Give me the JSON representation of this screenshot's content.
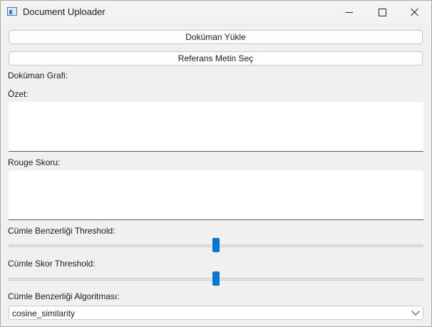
{
  "window": {
    "title": "Document Uploader",
    "app_icon": "window-app-icon"
  },
  "buttons": {
    "upload_document": "Doküman Yükle",
    "select_reference": "Referans Metin Seç"
  },
  "labels": {
    "document_graph": "Doküman Grafi:",
    "summary": "Özet:",
    "rouge_score": "Rouge Skoru:",
    "sentence_similarity_threshold": "Cümle Benzerliği Threshold:",
    "sentence_score_threshold": "Cümle Skor Threshold:",
    "similarity_algorithm": "Cümle Benzerliği Algoritması:"
  },
  "fields": {
    "summary_text": "",
    "rouge_text": ""
  },
  "sliders": {
    "similarity_threshold_fraction": 0.5,
    "score_threshold_fraction": 0.5,
    "accent_color": "#0078d4"
  },
  "algorithm_select": {
    "selected": "cosine_similarity"
  }
}
